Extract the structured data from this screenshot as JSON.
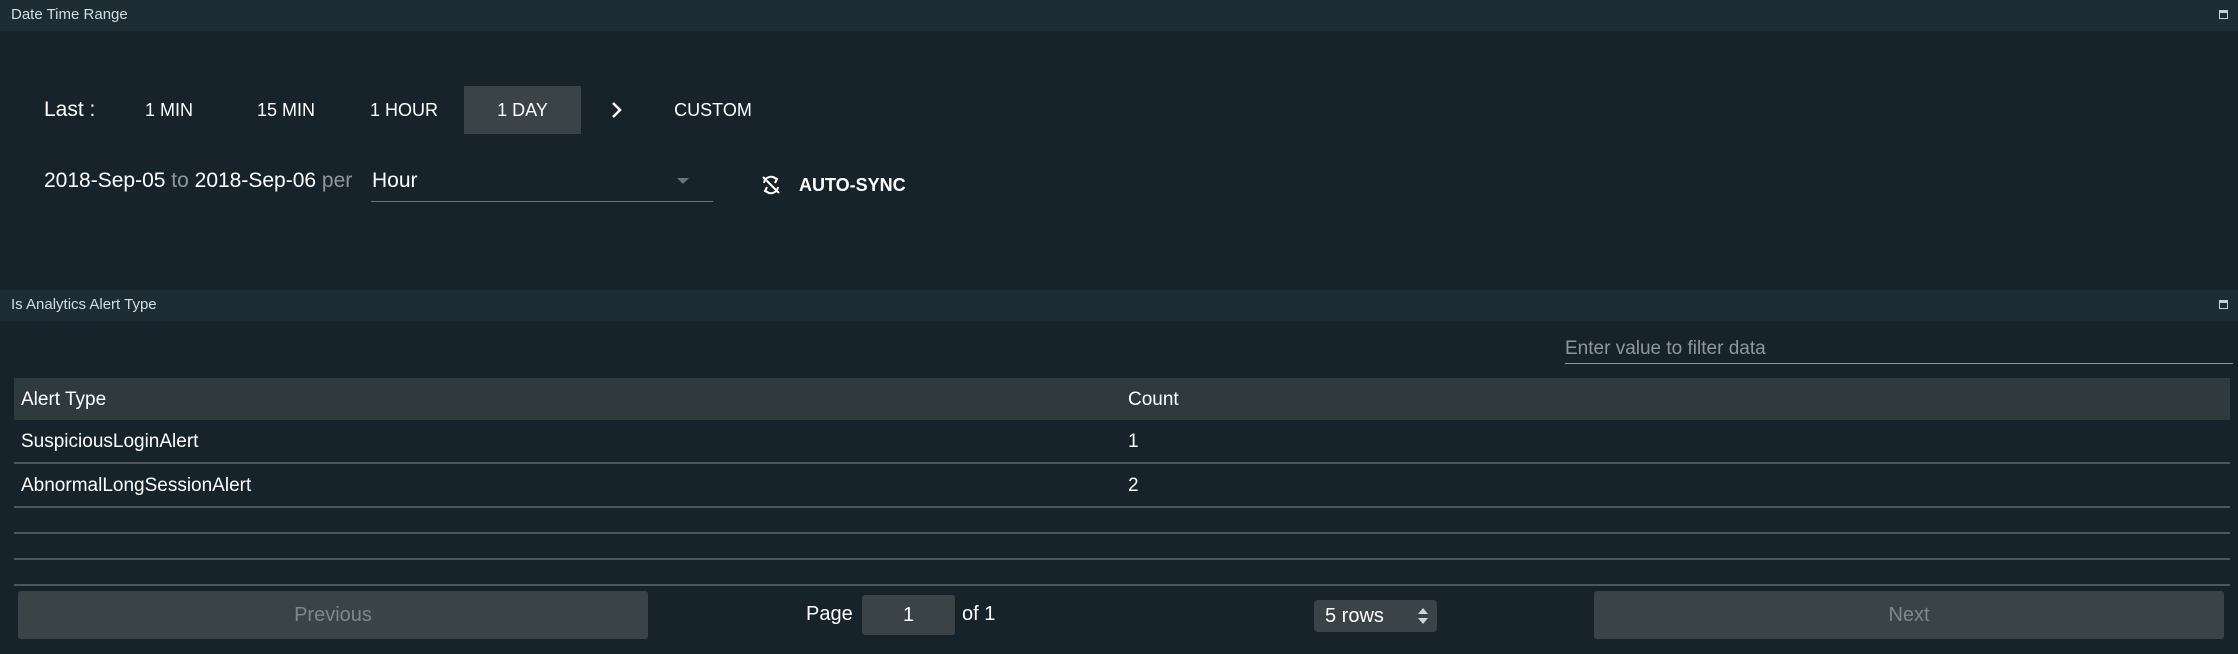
{
  "date_panel": {
    "title": "Date Time Range",
    "last_label": "Last :",
    "ranges": [
      "1 MIN",
      "15 MIN",
      "1 HOUR",
      "1 DAY"
    ],
    "active_range": "1 DAY",
    "custom_label": "CUSTOM",
    "from_date": "2018-Sep-05",
    "to_word": "to",
    "to_date": "2018-Sep-06",
    "per_word": "per",
    "granularity": "Hour",
    "auto_sync_label": "AUTO-SYNC"
  },
  "table_panel": {
    "title": "Is Analytics Alert Type",
    "filter_placeholder": "Enter value to filter data",
    "columns": [
      "Alert Type",
      "Count"
    ],
    "rows": [
      {
        "alert_type": "SuspiciousLoginAlert",
        "count": "1"
      },
      {
        "alert_type": "AbnormalLongSessionAlert",
        "count": "2"
      }
    ],
    "pagination": {
      "previous_label": "Previous",
      "page_label": "Page",
      "page_value": "1",
      "of_label": "of 1",
      "rows_option": "5 rows",
      "next_label": "Next"
    }
  },
  "colors": {
    "background": "#17232a",
    "header": "#1e2d35",
    "button_bg": "#3a4346",
    "muted_text": "#8e989c"
  },
  "icons": [
    "maximize-icon",
    "chevron-right-icon",
    "auto-sync-icon",
    "stepper-icon"
  ]
}
